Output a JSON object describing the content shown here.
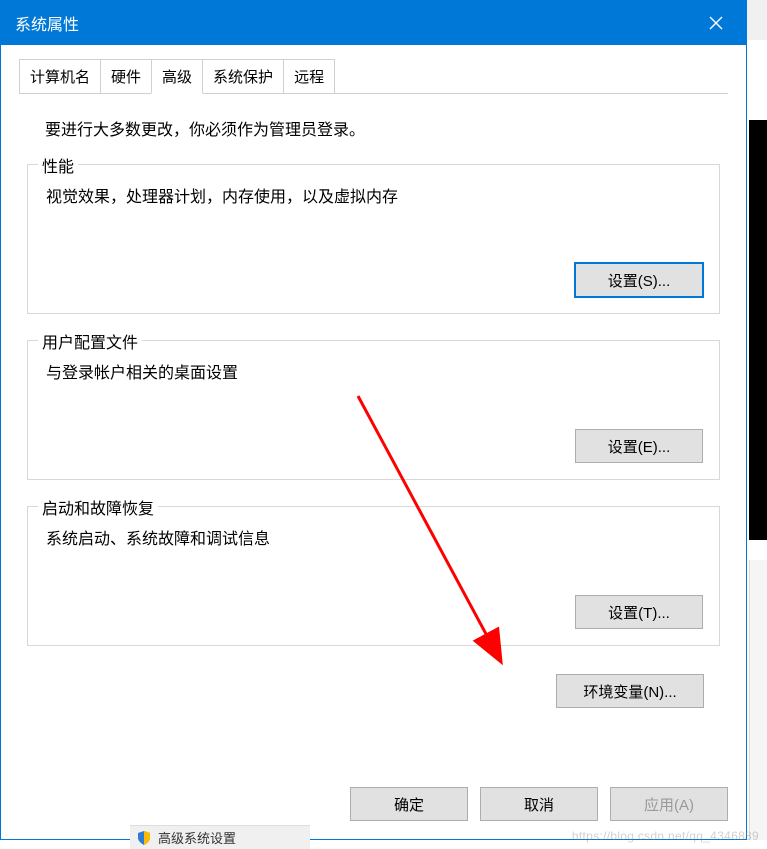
{
  "window": {
    "title": "系统属性"
  },
  "tabs": [
    {
      "label": "计算机名"
    },
    {
      "label": "硬件"
    },
    {
      "label": "高级",
      "active": true
    },
    {
      "label": "系统保护"
    },
    {
      "label": "远程"
    }
  ],
  "intro": "要进行大多数更改，你必须作为管理员登录。",
  "groups": {
    "performance": {
      "legend": "性能",
      "desc": "视觉效果，处理器计划，内存使用，以及虚拟内存",
      "button": "设置(S)..."
    },
    "profiles": {
      "legend": "用户配置文件",
      "desc": "与登录帐户相关的桌面设置",
      "button": "设置(E)..."
    },
    "startup": {
      "legend": "启动和故障恢复",
      "desc": "系统启动、系统故障和调试信息",
      "button": "设置(T)..."
    }
  },
  "env_button": "环境变量(N)...",
  "footer": {
    "ok": "确定",
    "cancel": "取消",
    "apply": "应用(A)"
  },
  "background_task": "高级系统设置",
  "watermark": "https://blog.csdn.net/qq_4346889"
}
